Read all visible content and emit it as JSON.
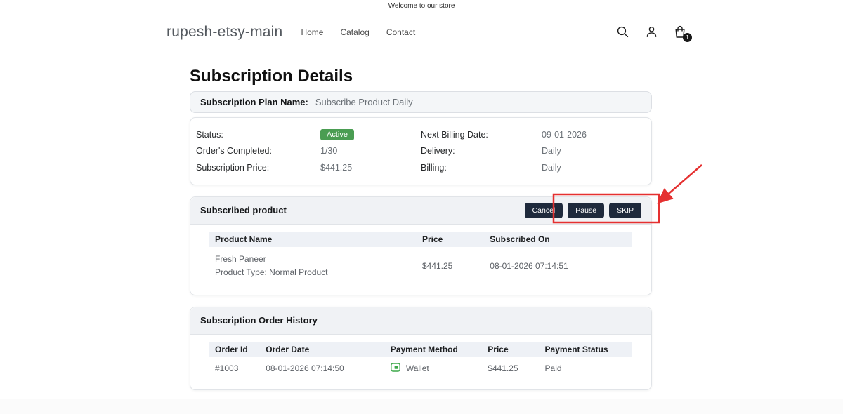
{
  "announcement": {
    "text": "Welcome to our store"
  },
  "header": {
    "logo": "rupesh-etsy-main",
    "nav": [
      {
        "label": "Home"
      },
      {
        "label": "Catalog"
      },
      {
        "label": "Contact"
      }
    ],
    "cart_badge": "1"
  },
  "page": {
    "title": "Subscription Details",
    "plan": {
      "label": "Subscription Plan Name:",
      "value": "Subscribe Product Daily"
    },
    "details": {
      "rows_left": [
        {
          "label": "Status:",
          "value": "Active"
        },
        {
          "label": "Order's Completed:",
          "value": "1/30"
        },
        {
          "label": "Subscription Price:",
          "value": "$441.25"
        }
      ],
      "rows_right": [
        {
          "label": "Next Billing Date:",
          "value": "09-01-2026"
        },
        {
          "label": "Delivery:",
          "value": "Daily"
        },
        {
          "label": "Billing:",
          "value": "Daily"
        }
      ]
    },
    "subscribed_product": {
      "title": "Subscribed product",
      "buttons": [
        {
          "label": "Cancel"
        },
        {
          "label": "Pause"
        },
        {
          "label": "SKIP"
        }
      ],
      "table": {
        "headers": [
          "Product Name",
          "Price",
          "Subscribed On"
        ],
        "row": {
          "name": "Fresh Paneer",
          "type": "Product Type: Normal Product",
          "price": "$441.25",
          "subscribed_on": "08-01-2026 07:14:51"
        }
      }
    },
    "order_history": {
      "title": "Subscription Order History",
      "table": {
        "headers": [
          "Order Id",
          "Order Date",
          "Payment Method",
          "Price",
          "Payment Status"
        ],
        "row": {
          "order_id": "#1003",
          "order_date": "08-01-2026 07:14:50",
          "payment_method": "Wallet",
          "price": "$441.25",
          "payment_status": "Paid"
        }
      }
    }
  },
  "colors": {
    "badge_green": "#4a9d52",
    "paid_green": "#4caf50",
    "button_navy": "#1f2a3c",
    "annotation_red": "#e53030"
  }
}
